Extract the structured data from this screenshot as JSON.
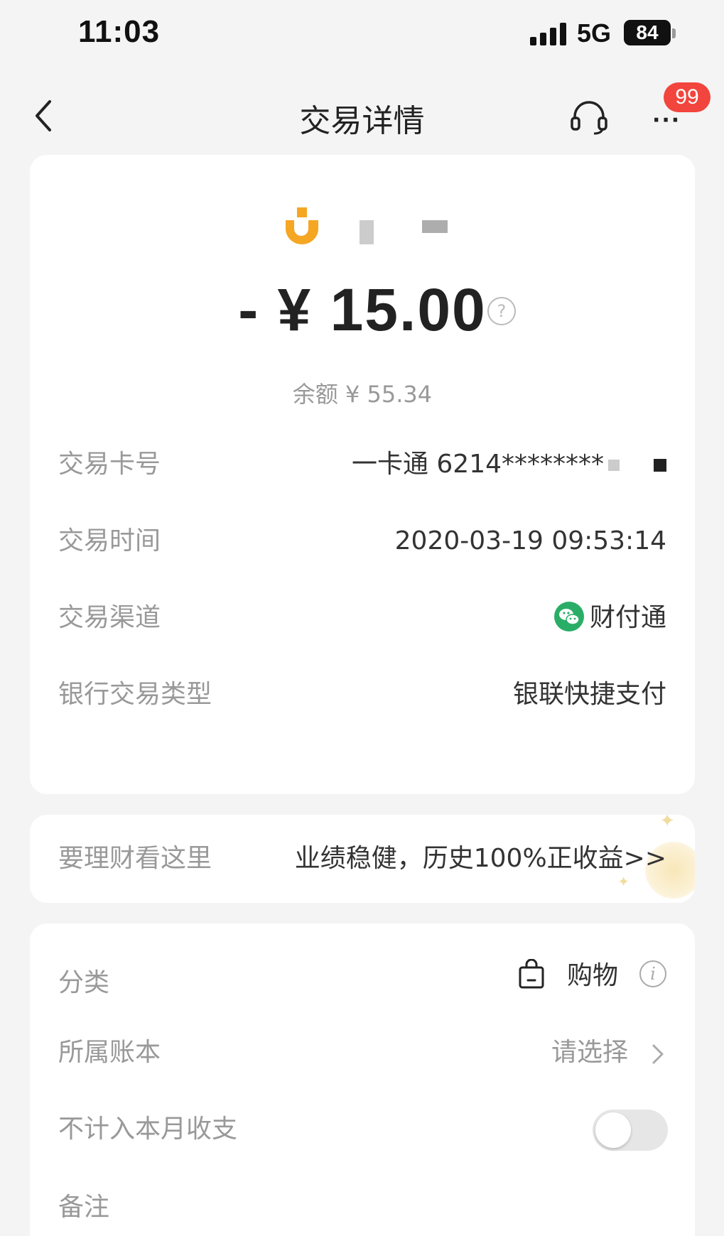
{
  "status_bar": {
    "time": "11:03",
    "network": "5G",
    "battery": "84"
  },
  "header": {
    "title": "交易详情",
    "back_icon": "chevron-left-icon",
    "service_icon": "headset-icon",
    "more_icon": "more-icon",
    "more_badge": "99"
  },
  "transaction": {
    "merchant_icon": "merchant-logo",
    "amount": "- ¥ 15.00",
    "amount_help": "?",
    "balance": "余额 ¥ 55.34",
    "details": [
      {
        "label": "交易卡号",
        "value": "一卡通 6214********"
      },
      {
        "label": "交易时间",
        "value": "2020-03-19 09:53:14"
      },
      {
        "label": "交易渠道",
        "value": "财付通",
        "icon": "wechat-icon"
      },
      {
        "label": "银行交易类型",
        "value": "银联快捷支付"
      }
    ]
  },
  "promo": {
    "label": "要理财看这里",
    "value": "业绩稳健，历史100%正收益>>"
  },
  "meta": {
    "category": {
      "label": "分类",
      "value": "购物",
      "icon": "shopping-bag-icon",
      "info": "i"
    },
    "ledger": {
      "label": "所属账本",
      "value": "请选择",
      "icon": "chevron-right-icon"
    },
    "exclude": {
      "label": "不计入本月收支",
      "enabled": false
    },
    "note": {
      "label": "备注"
    }
  },
  "colors": {
    "background": "#f4f4f4",
    "card": "#ffffff",
    "badge": "#f2453d",
    "merchant_orange": "#f5a623",
    "wechat_green": "#2aae67",
    "label_gray": "#999999"
  }
}
